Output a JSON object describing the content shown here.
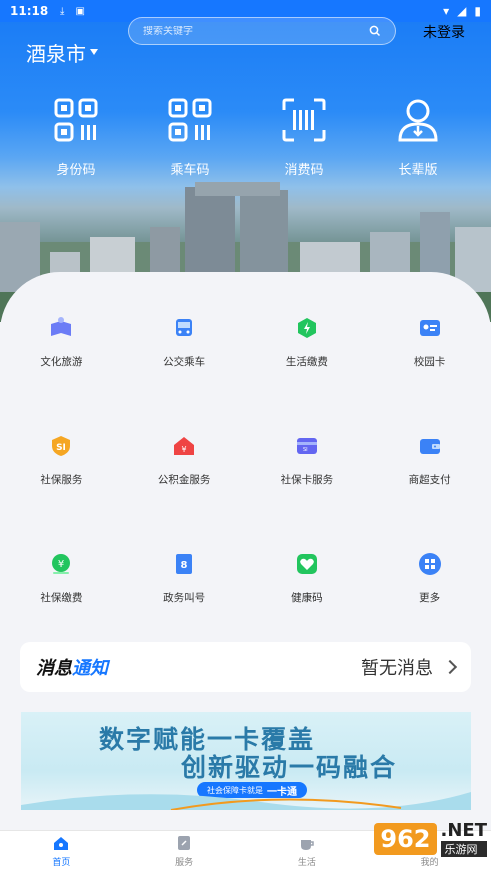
{
  "status_bar": {
    "time": "11:18"
  },
  "header": {
    "city": "酒泉市",
    "search_placeholder": "搜索关键字",
    "login": "未登录"
  },
  "quick_actions": [
    {
      "label": "身份码",
      "icon": "qr-code-icon"
    },
    {
      "label": "乘车码",
      "icon": "qr-code-icon"
    },
    {
      "label": "消费码",
      "icon": "scan-code-icon"
    },
    {
      "label": "长辈版",
      "icon": "elder-user-icon"
    }
  ],
  "services": [
    {
      "label": "文化旅游",
      "icon": "culture-tourism-icon",
      "color": "#6b7cf6"
    },
    {
      "label": "公交乘车",
      "icon": "bus-icon",
      "color": "#3b82f6"
    },
    {
      "label": "生活缴费",
      "icon": "utility-payment-icon",
      "color": "#22c55e"
    },
    {
      "label": "校园卡",
      "icon": "campus-card-icon",
      "color": "#3b82f6"
    },
    {
      "label": "社保服务",
      "icon": "social-security-icon",
      "color": "#f5a623"
    },
    {
      "label": "公积金服务",
      "icon": "housing-fund-icon",
      "color": "#ef4444"
    },
    {
      "label": "社保卡服务",
      "icon": "social-card-icon",
      "color": "#6366f1"
    },
    {
      "label": "商超支付",
      "icon": "wallet-icon",
      "color": "#3b82f6"
    },
    {
      "label": "社保缴费",
      "icon": "social-payment-icon",
      "color": "#22c55e"
    },
    {
      "label": "政务叫号",
      "icon": "queue-number-icon",
      "color": "#3b82f6"
    },
    {
      "label": "健康码",
      "icon": "health-code-icon",
      "color": "#22c55e"
    },
    {
      "label": "更多",
      "icon": "more-grid-icon",
      "color": "#3b82f6"
    }
  ],
  "notice": {
    "title_a": "消息",
    "title_b": "通知",
    "status": "暂无消息"
  },
  "banner": {
    "line1": "数字赋能一卡覆盖",
    "line2": "创新驱动一码融合",
    "pill_small": "社会保障卡就是",
    "pill_big": "一卡通"
  },
  "tabs": [
    {
      "label": "首页",
      "active": true
    },
    {
      "label": "服务",
      "active": false
    },
    {
      "label": "生活",
      "active": false
    },
    {
      "label": "我的",
      "active": false
    }
  ],
  "watermark": {
    "brand": "962",
    "suffix": ".NET",
    "sub": "乐游网"
  }
}
